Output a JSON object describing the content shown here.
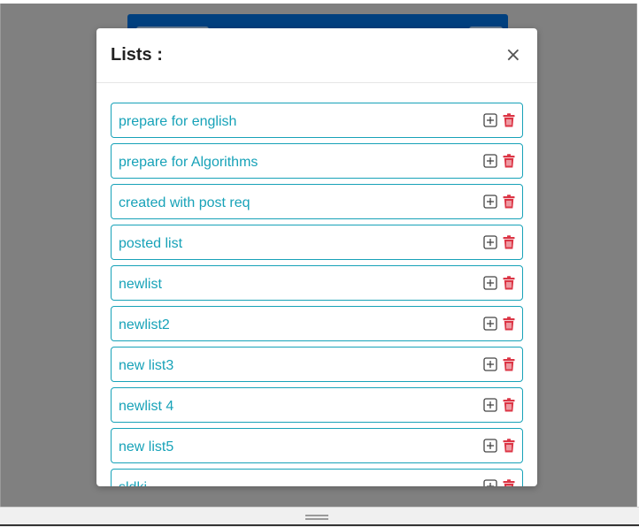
{
  "modal": {
    "title": "Lists :",
    "close_symbol": "×"
  },
  "lists": [
    {
      "label": "prepare for english"
    },
    {
      "label": "prepare for Algorithms"
    },
    {
      "label": "created with post req"
    },
    {
      "label": "posted list"
    },
    {
      "label": "newlist"
    },
    {
      "label": "newlist2"
    },
    {
      "label": "new list3"
    },
    {
      "label": "newlist 4"
    },
    {
      "label": "new list5"
    },
    {
      "label": "sldki"
    }
  ],
  "icons": {
    "add": "plus-square-icon",
    "delete": "trash-icon"
  },
  "colors": {
    "accent": "#17a2b8",
    "danger": "#dc3545",
    "header_bg": "#00407f",
    "backdrop": "#808080"
  }
}
